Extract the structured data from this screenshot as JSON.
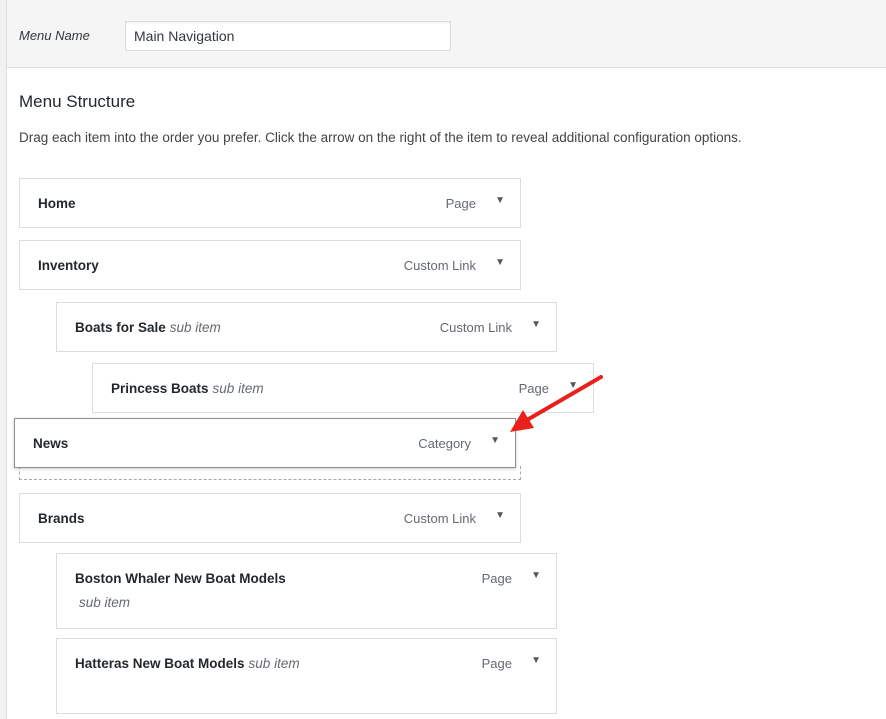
{
  "header": {
    "menu_name_label": "Menu Name",
    "menu_name_value": "Main Navigation"
  },
  "structure": {
    "title": "Menu Structure",
    "instructions": "Drag each item into the order you prefer. Click the arrow on the right of the item to reveal additional configuration options."
  },
  "items": [
    {
      "title": "Home",
      "sub": "",
      "type": "Page"
    },
    {
      "title": "Inventory",
      "sub": "",
      "type": "Custom Link"
    },
    {
      "title": "Boats for Sale",
      "sub": "sub item",
      "type": "Custom Link"
    },
    {
      "title": "Princess Boats",
      "sub": "sub item",
      "type": "Page"
    },
    {
      "title": "News",
      "sub": "",
      "type": "Category"
    },
    {
      "title": "Brands",
      "sub": "",
      "type": "Custom Link"
    },
    {
      "title": "Boston Whaler New Boat Models",
      "sub": "sub item",
      "type": "Page"
    },
    {
      "title": "Hatteras New Boat Models",
      "sub": "sub item",
      "type": "Page"
    }
  ],
  "icons": {
    "toggle": "triangle-down-icon",
    "annotation": "red-arrow-icon"
  },
  "colors": {
    "annotation_arrow": "#e8211c",
    "item_border": "#dddddd"
  }
}
